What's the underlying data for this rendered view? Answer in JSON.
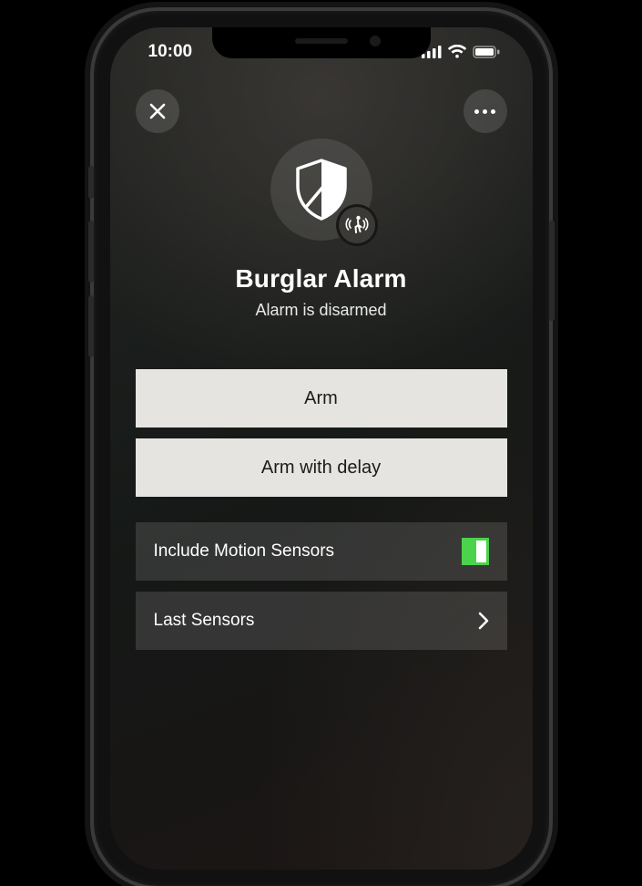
{
  "status": {
    "time": "10:00"
  },
  "hero": {
    "title": "Burglar Alarm",
    "subtitle": "Alarm is disarmed"
  },
  "buttons": {
    "arm": "Arm",
    "arm_delay": "Arm with delay"
  },
  "rows": {
    "motion": {
      "label": "Include Motion Sensors",
      "state": "on"
    },
    "last_sensors": {
      "label": "Last Sensors"
    }
  }
}
